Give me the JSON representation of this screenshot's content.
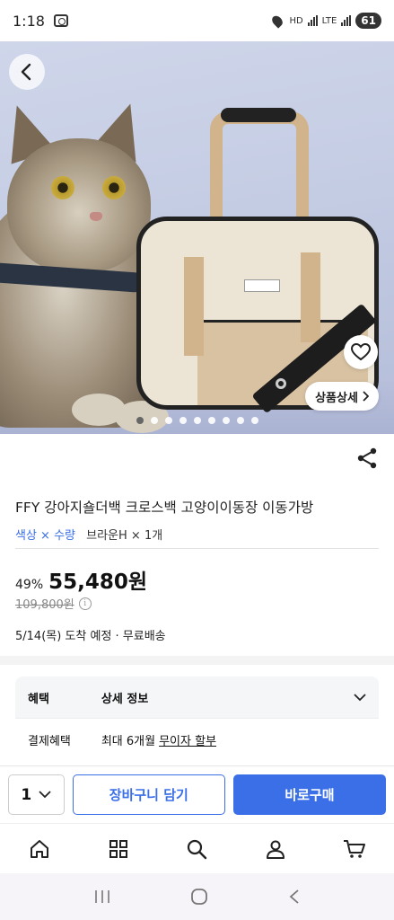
{
  "status_bar": {
    "time": "1:18",
    "network": "HD",
    "lte": "LTE",
    "battery": "61"
  },
  "hero": {
    "detail_button_label": "상품상세",
    "slide_count": 9,
    "active_slide": 1,
    "bag_brand_label": "HOPERAM"
  },
  "product": {
    "title": "FFY 강아지숄더백 크로스백 고양이이동장 이동가방",
    "option_key": "색상 × 수량",
    "option_value": "브라운H × 1개",
    "discount": "49%",
    "price": "55,480원",
    "original_price": "109,800원",
    "info_icon": "i",
    "delivery": "5/14(목) 도착 예정 · 무료배송"
  },
  "benefits": {
    "header_col1": "혜택",
    "header_col2": "상세 정보",
    "rows": [
      {
        "label": "결제혜택",
        "text": "최대 6개월",
        "link": "무이자 할부"
      }
    ]
  },
  "action_bar": {
    "quantity": "1",
    "cart_label": "장바구니 담기",
    "buy_label": "바로구매"
  },
  "tabs": [
    "home-icon",
    "grid-icon",
    "search-icon",
    "user-icon",
    "cart-icon"
  ],
  "colors": {
    "accent": "#3a6fe8",
    "option_key": "#3a6fe8"
  }
}
